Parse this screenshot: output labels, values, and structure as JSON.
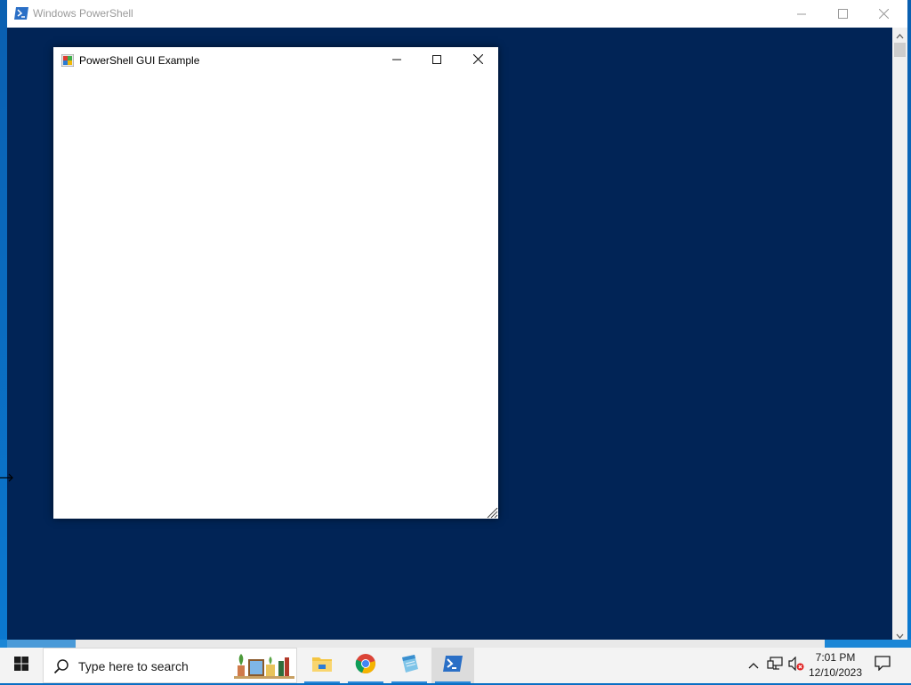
{
  "console_window": {
    "title": "Windows PowerShell",
    "minimize_glyph": "minimize-icon",
    "maximize_glyph": "maximize-icon",
    "close_glyph": "close-icon",
    "background_color": "#012456"
  },
  "form_window": {
    "title": "PowerShell GUI Example",
    "background_color": "#ffffff"
  },
  "taskbar": {
    "search_placeholder": "Type here to search",
    "apps": [
      {
        "name": "file-explorer",
        "running": true
      },
      {
        "name": "google-chrome",
        "running": true
      },
      {
        "name": "notepad",
        "running": true
      },
      {
        "name": "windows-powershell",
        "running": true,
        "active": true
      }
    ],
    "clock": {
      "time": "7:01 PM",
      "date": "12/10/2023"
    },
    "accent_color": "#2b88d8"
  }
}
